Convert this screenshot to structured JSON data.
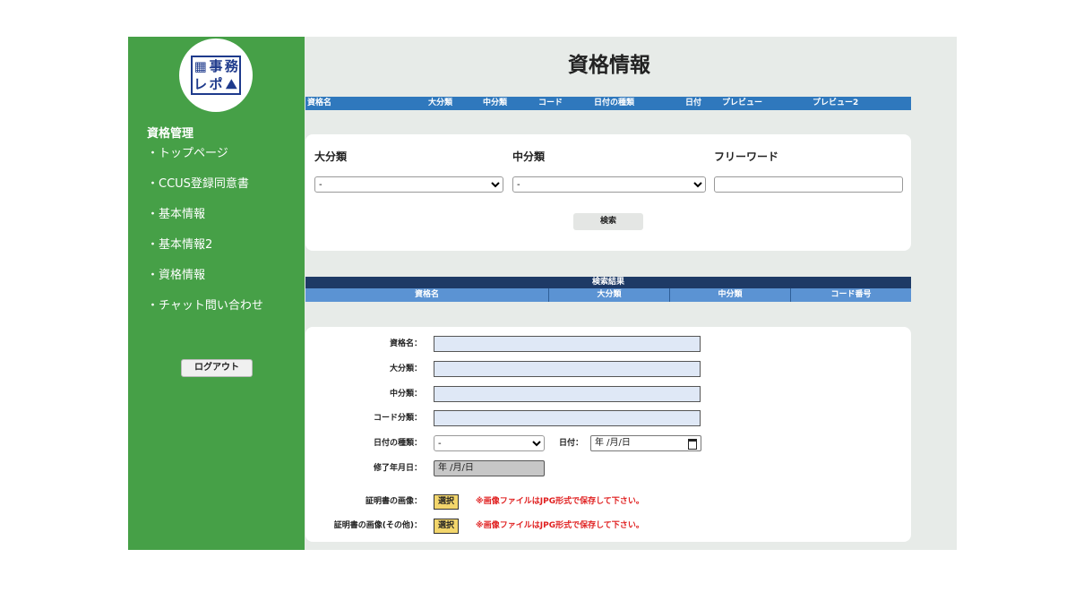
{
  "logo": {
    "chars": [
      "▦",
      "事",
      "務",
      "レ",
      "ポ",
      "⛰"
    ],
    "brand_color": "#1e3a8c"
  },
  "sidebar": {
    "heading": "資格管理",
    "items": [
      {
        "label": "・トップページ"
      },
      {
        "label": "・CCUS登録同意書"
      },
      {
        "label": "・基本情報"
      },
      {
        "label": "・基本情報2"
      },
      {
        "label": "・資格情報"
      },
      {
        "label": "・チャット問い合わせ"
      }
    ],
    "logout_label": "ログアウト",
    "bg_color": "#46a047"
  },
  "page": {
    "title": "資格情報"
  },
  "column_bar": {
    "columns": [
      "資格名",
      "大分類",
      "中分類",
      "コード",
      "日付の種類",
      "日付",
      "プレビュー",
      "プレビュー2"
    ],
    "bg_color": "#2f78bd"
  },
  "search": {
    "major_label": "大分類",
    "minor_label": "中分類",
    "freeword_label": "フリーワード",
    "major_value": "-",
    "minor_value": "-",
    "freeword_value": "",
    "button_label": "検索"
  },
  "results": {
    "title": "検索結果",
    "columns": [
      "資格名",
      "大分類",
      "中分類",
      "コード番号"
    ]
  },
  "form": {
    "name_label": "資格名：",
    "major_label": "大分類：",
    "minor_label": "中分類：",
    "code_label": "コード分類：",
    "date_type_label": "日付の種類：",
    "date_type_value": "-",
    "date_label": "日付：",
    "date_placeholder": "年 /月/日",
    "completion_label": "修了年月日：",
    "completion_placeholder": "年 /月/日",
    "cert_image_label": "証明書の画像：",
    "cert_image_other_label": "証明書の画像(その他)：",
    "pick_label": "選択",
    "warning": "※画像ファイルはJPG形式で保存して下さい。"
  }
}
